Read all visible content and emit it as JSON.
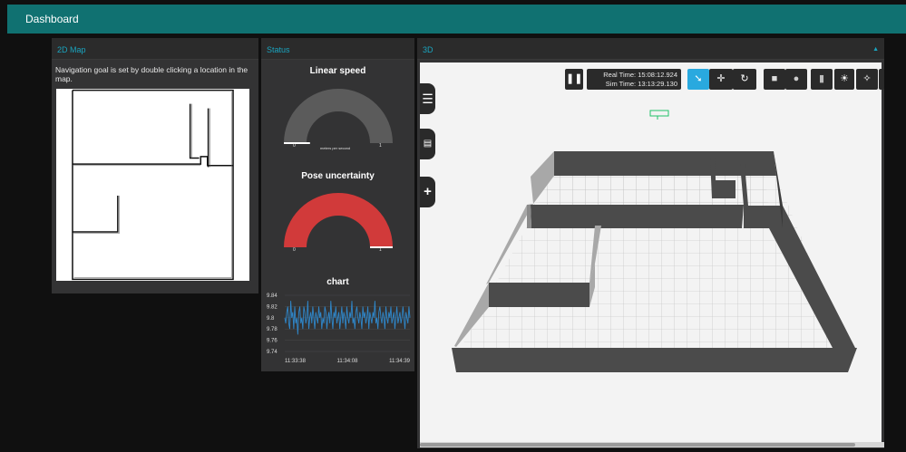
{
  "topbar": {
    "title": "Dashboard"
  },
  "map_panel": {
    "title": "2D Map",
    "description": "Navigation goal is set by double clicking a location in the map."
  },
  "status_panel": {
    "title": "Status",
    "linear_speed": {
      "title": "Linear speed",
      "min_label": "0",
      "max_label": "1",
      "unit_label": "meters per second",
      "value_fraction": 0.15,
      "color": "#5b5b5b"
    },
    "pose_uncertainty": {
      "title": "Pose uncertainty",
      "min_label": "0",
      "max_label": "1",
      "value_fraction": 1.0,
      "color": "#d13a3a"
    },
    "chart": {
      "title": "chart",
      "y_ticks": [
        "9.84",
        "9.82",
        "9.8",
        "9.78",
        "9.76",
        "9.74"
      ],
      "x_ticks": [
        "11:33:38",
        "11:34:08",
        "11:34:39"
      ]
    }
  },
  "chart_data": {
    "type": "line",
    "title": "chart",
    "xlabel": "",
    "ylabel": "",
    "ylim": [
      9.74,
      9.84
    ],
    "x_ticks": [
      "11:33:38",
      "11:34:08",
      "11:34:39"
    ],
    "series": [
      {
        "values": [
          9.8,
          9.79,
          9.81,
          9.82,
          9.79,
          9.78,
          9.83,
          9.8,
          9.81,
          9.78,
          9.82,
          9.79,
          9.8,
          9.77,
          9.81,
          9.82,
          9.79,
          9.8,
          9.78,
          9.82,
          9.81,
          9.79,
          9.8,
          9.83,
          9.78,
          9.8,
          9.81,
          9.79,
          9.82,
          9.8,
          9.78,
          9.81,
          9.8,
          9.79,
          9.82,
          9.8,
          9.81,
          9.78,
          9.8,
          9.79,
          9.82,
          9.81,
          9.78,
          9.8,
          9.81,
          9.79,
          9.83,
          9.8,
          9.78,
          9.81,
          9.8,
          9.82,
          9.79,
          9.8,
          9.81,
          9.78,
          9.8,
          9.82,
          9.79,
          9.81,
          9.8,
          9.78,
          9.82,
          9.8,
          9.79,
          9.81,
          9.8,
          9.83,
          9.79,
          9.8,
          9.78,
          9.81,
          9.82,
          9.8,
          9.79,
          9.81,
          9.8,
          9.78,
          9.82,
          9.8,
          9.81,
          9.79,
          9.8,
          9.82,
          9.78,
          9.81,
          9.8,
          9.79,
          9.81,
          9.8,
          9.83,
          9.79,
          9.8,
          9.78,
          9.81,
          9.82,
          9.8,
          9.79,
          9.81,
          9.8,
          9.78,
          9.82,
          9.8,
          9.79,
          9.81,
          9.8,
          9.82,
          9.79,
          9.8,
          9.81,
          9.78,
          9.8,
          9.82,
          9.79,
          9.8,
          9.81,
          9.79,
          9.8,
          9.82,
          9.8,
          9.78,
          9.81,
          9.8,
          9.79,
          9.82,
          9.8
        ],
        "color": "#2f86c8"
      }
    ]
  },
  "threed_panel": {
    "title": "3D",
    "real_time_label": "Real Time: 15:08:12.924",
    "sim_time_label": "Sim Time: 13:13:29.130"
  }
}
